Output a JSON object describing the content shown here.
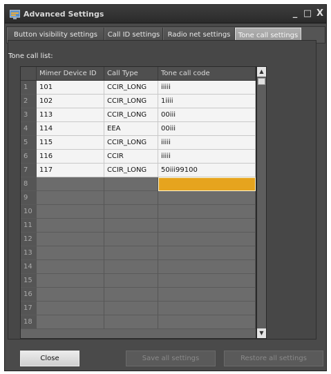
{
  "window": {
    "title": "Advanced Settings",
    "minimize_glyph": "_",
    "maximize_glyph": "□",
    "close_glyph": "X"
  },
  "tabs": [
    {
      "label": "Button visibility settings",
      "active": false
    },
    {
      "label": "Call ID settings",
      "active": false
    },
    {
      "label": "Radio net settings",
      "active": false
    },
    {
      "label": "Tone call settings",
      "active": true
    }
  ],
  "tone_call_list": {
    "label": "Tone call list:",
    "columns": [
      "",
      "Mimer Device ID",
      "Call Type",
      "Tone call code"
    ],
    "rows": [
      {
        "num": "1",
        "id": "101",
        "type": "CCIR_LONG",
        "code": "iiiii"
      },
      {
        "num": "2",
        "id": "102",
        "type": "CCIR_LONG",
        "code": "1iiii"
      },
      {
        "num": "3",
        "id": "113",
        "type": "CCIR_LONG",
        "code": "00iii"
      },
      {
        "num": "4",
        "id": "114",
        "type": "EEA",
        "code": "00iii"
      },
      {
        "num": "5",
        "id": "115",
        "type": "CCIR_LONG",
        "code": "iiiii"
      },
      {
        "num": "6",
        "id": "116",
        "type": "CCIR",
        "code": "iiiii"
      },
      {
        "num": "7",
        "id": "117",
        "type": "CCIR_LONG",
        "code": "50iii99100"
      },
      {
        "num": "8",
        "id": "",
        "type": "",
        "code": ""
      },
      {
        "num": "9",
        "id": "",
        "type": "",
        "code": ""
      },
      {
        "num": "10",
        "id": "",
        "type": "",
        "code": ""
      },
      {
        "num": "11",
        "id": "",
        "type": "",
        "code": ""
      },
      {
        "num": "12",
        "id": "",
        "type": "",
        "code": ""
      },
      {
        "num": "13",
        "id": "",
        "type": "",
        "code": ""
      },
      {
        "num": "14",
        "id": "",
        "type": "",
        "code": ""
      },
      {
        "num": "15",
        "id": "",
        "type": "",
        "code": ""
      },
      {
        "num": "16",
        "id": "",
        "type": "",
        "code": ""
      },
      {
        "num": "17",
        "id": "",
        "type": "",
        "code": ""
      },
      {
        "num": "18",
        "id": "",
        "type": "",
        "code": ""
      }
    ],
    "editing_row": 8
  },
  "footer": {
    "close_label": "Close",
    "save_label": "Save all settings",
    "restore_label": "Restore all settings"
  },
  "colors": {
    "window_bg": "#4a4a4a",
    "cell_fill": "#f4f4f4",
    "empty_cell": "#6c6c6c",
    "editing_highlight": "#e6a41e"
  },
  "icons": {
    "app": "settings-app-icon",
    "scroll_up": "scroll-up-arrow-icon",
    "scroll_down": "scroll-down-arrow-icon"
  }
}
